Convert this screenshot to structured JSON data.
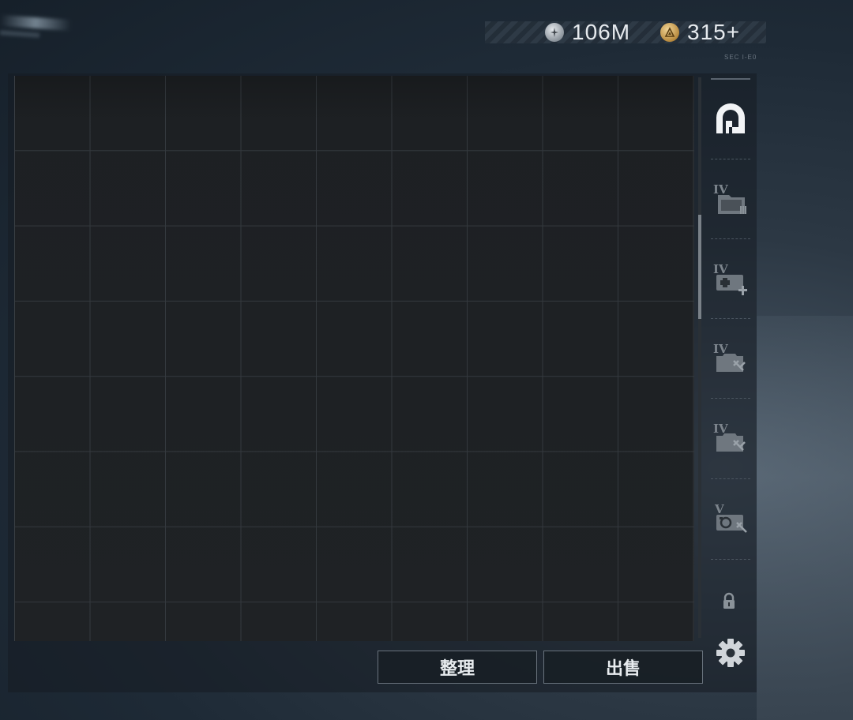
{
  "currency": {
    "silver": {
      "amount": "106M",
      "icon": "silver-coin-icon"
    },
    "gold": {
      "amount": "315+",
      "icon": "gold-coin-icon"
    },
    "version_text": "SEC I-E0"
  },
  "sidebar": {
    "tabs": [
      {
        "icon": "main-storage-icon",
        "level": "",
        "active": true
      },
      {
        "icon": "storage-case-ammo-icon",
        "level": "IV"
      },
      {
        "icon": "storage-case-medical-icon",
        "level": "IV"
      },
      {
        "icon": "storage-case-weapon-icon",
        "level": "IV"
      },
      {
        "icon": "storage-case-weapon-icon",
        "level": "IV"
      },
      {
        "icon": "storage-case-gear-icon",
        "level": "V"
      }
    ],
    "locked_slot_icon": "lock-icon",
    "settings_icon": "gear-icon"
  },
  "stash": {
    "columns": 9,
    "rows_visible": 8,
    "scroll_position": 0.25
  },
  "buttons": {
    "sort_label": "整理",
    "sell_label": "出售"
  },
  "colors": {
    "grid_bg": "#1e2124",
    "grid_line": "#34393e",
    "button_border": "#69737d",
    "text": "#e6eaee"
  }
}
